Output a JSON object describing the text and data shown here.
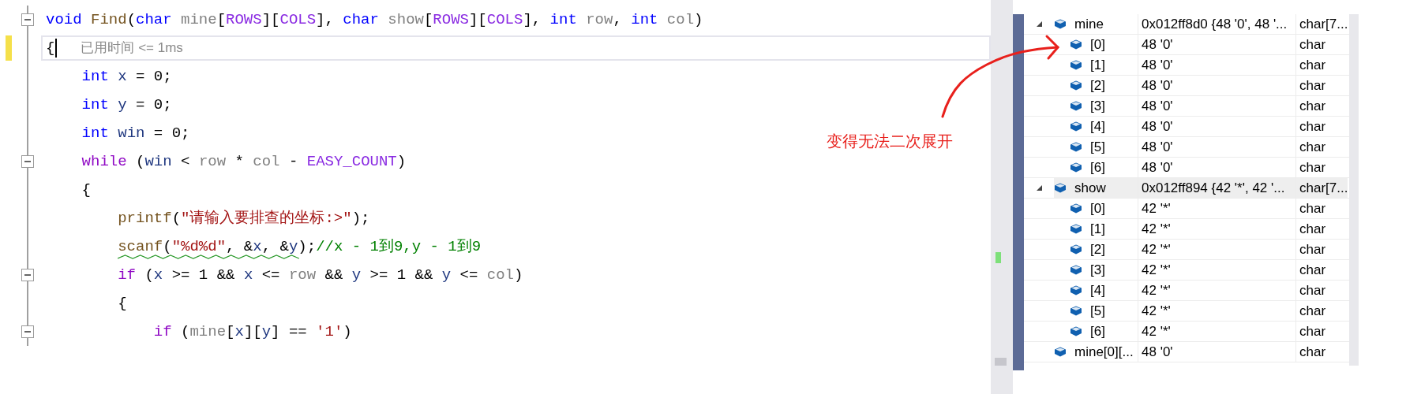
{
  "editor": {
    "lines": [
      {
        "fold": true,
        "current": false,
        "tokens": [
          {
            "text": "void",
            "kind": "kw"
          },
          {
            "text": " Find",
            "kind": "fn"
          },
          {
            "text": "(",
            "kind": "p"
          },
          {
            "text": "char",
            "kind": "kw"
          },
          {
            "text": " mine",
            "kind": "prm"
          },
          {
            "text": "[",
            "kind": "p"
          },
          {
            "text": "ROWS",
            "kind": "mac"
          },
          {
            "text": "][",
            "kind": "p"
          },
          {
            "text": "COLS",
            "kind": "mac"
          },
          {
            "text": "], ",
            "kind": "p"
          },
          {
            "text": "char",
            "kind": "kw"
          },
          {
            "text": " show",
            "kind": "prm"
          },
          {
            "text": "[",
            "kind": "p"
          },
          {
            "text": "ROWS",
            "kind": "mac"
          },
          {
            "text": "][",
            "kind": "p"
          },
          {
            "text": "COLS",
            "kind": "mac"
          },
          {
            "text": "], ",
            "kind": "p"
          },
          {
            "text": "int",
            "kind": "kw"
          },
          {
            "text": " row",
            "kind": "prm"
          },
          {
            "text": ", ",
            "kind": "p"
          },
          {
            "text": "int",
            "kind": "kw"
          },
          {
            "text": " col",
            "kind": "prm"
          },
          {
            "text": ")",
            "kind": "p"
          }
        ]
      },
      {
        "fold": false,
        "current": true,
        "hint": "已用时间 <= 1ms",
        "tokens": [
          {
            "text": "{",
            "kind": "p"
          }
        ]
      },
      {
        "fold": false,
        "current": false,
        "tokens": [
          {
            "text": "    int",
            "kind": "kw"
          },
          {
            "text": " x",
            "kind": "var"
          },
          {
            "text": " = 0;",
            "kind": "p"
          }
        ]
      },
      {
        "fold": false,
        "current": false,
        "tokens": [
          {
            "text": "    int",
            "kind": "kw"
          },
          {
            "text": " y",
            "kind": "var"
          },
          {
            "text": " = 0;",
            "kind": "p"
          }
        ]
      },
      {
        "fold": false,
        "current": false,
        "tokens": [
          {
            "text": "    int",
            "kind": "kw"
          },
          {
            "text": " win",
            "kind": "var"
          },
          {
            "text": " = 0;",
            "kind": "p"
          }
        ]
      },
      {
        "fold": true,
        "current": false,
        "tokens": [
          {
            "text": "    while",
            "kind": "ctl"
          },
          {
            "text": " (",
            "kind": "p"
          },
          {
            "text": "win",
            "kind": "var"
          },
          {
            "text": " < ",
            "kind": "p"
          },
          {
            "text": "row",
            "kind": "prm"
          },
          {
            "text": " * ",
            "kind": "p"
          },
          {
            "text": "col",
            "kind": "prm"
          },
          {
            "text": " - ",
            "kind": "p"
          },
          {
            "text": "EASY_COUNT",
            "kind": "mac"
          },
          {
            "text": ")",
            "kind": "p"
          }
        ]
      },
      {
        "fold": false,
        "current": false,
        "tokens": [
          {
            "text": "    {",
            "kind": "p"
          }
        ]
      },
      {
        "fold": false,
        "current": false,
        "tokens": [
          {
            "text": "        printf",
            "kind": "fn"
          },
          {
            "text": "(",
            "kind": "p"
          },
          {
            "text": "\"请输入要排查的坐标:>\"",
            "kind": "str"
          },
          {
            "text": ");",
            "kind": "p"
          }
        ]
      },
      {
        "fold": false,
        "current": false,
        "squiggly": [
          {
            "text": "        scanf",
            "kind": "fn"
          },
          {
            "text": "(",
            "kind": "p"
          },
          {
            "text": "\"%d%d\"",
            "kind": "str"
          },
          {
            "text": ", &",
            "kind": "p"
          },
          {
            "text": "x",
            "kind": "var"
          },
          {
            "text": ", &",
            "kind": "p"
          },
          {
            "text": "y",
            "kind": "var"
          },
          {
            "text": ")",
            "kind": "p"
          }
        ],
        "tokens": [
          {
            "text": ";",
            "kind": "p"
          },
          {
            "text": "//x - 1到9,y - 1到9",
            "kind": "cmt"
          }
        ]
      },
      {
        "fold": true,
        "current": false,
        "tokens": [
          {
            "text": "        if",
            "kind": "ctl"
          },
          {
            "text": " (",
            "kind": "p"
          },
          {
            "text": "x",
            "kind": "var"
          },
          {
            "text": " >= 1 && ",
            "kind": "p"
          },
          {
            "text": "x",
            "kind": "var"
          },
          {
            "text": " <= ",
            "kind": "p"
          },
          {
            "text": "row",
            "kind": "prm"
          },
          {
            "text": " && ",
            "kind": "p"
          },
          {
            "text": "y",
            "kind": "var"
          },
          {
            "text": " >= 1 && ",
            "kind": "p"
          },
          {
            "text": "y",
            "kind": "var"
          },
          {
            "text": " <= ",
            "kind": "p"
          },
          {
            "text": "col",
            "kind": "prm"
          },
          {
            "text": ")",
            "kind": "p"
          }
        ]
      },
      {
        "fold": false,
        "current": false,
        "tokens": [
          {
            "text": "        {",
            "kind": "p"
          }
        ]
      },
      {
        "fold": true,
        "current": false,
        "tokens": [
          {
            "text": "            if",
            "kind": "ctl"
          },
          {
            "text": " (",
            "kind": "p"
          },
          {
            "text": "mine",
            "kind": "prm"
          },
          {
            "text": "[",
            "kind": "p"
          },
          {
            "text": "x",
            "kind": "var"
          },
          {
            "text": "][",
            "kind": "p"
          },
          {
            "text": "y",
            "kind": "var"
          },
          {
            "text": "] == ",
            "kind": "p"
          },
          {
            "text": "'1'",
            "kind": "str"
          },
          {
            "text": ")",
            "kind": "p"
          }
        ]
      }
    ]
  },
  "watch": {
    "rows": [
      {
        "kind": "array",
        "expanded": true,
        "selected": false,
        "name": "mine",
        "value": "0x012ff8d0 {48 '0', 48 '...",
        "type": "char[7...",
        "children": [
          {
            "name": "[0]",
            "value": "48 '0'",
            "type": "char",
            "selected": false
          },
          {
            "name": "[1]",
            "value": "48 '0'",
            "type": "char",
            "selected": false
          },
          {
            "name": "[2]",
            "value": "48 '0'",
            "type": "char",
            "selected": false
          },
          {
            "name": "[3]",
            "value": "48 '0'",
            "type": "char",
            "selected": false
          },
          {
            "name": "[4]",
            "value": "48 '0'",
            "type": "char",
            "selected": false
          },
          {
            "name": "[5]",
            "value": "48 '0'",
            "type": "char",
            "selected": false
          },
          {
            "name": "[6]",
            "value": "48 '0'",
            "type": "char",
            "selected": false
          }
        ]
      },
      {
        "kind": "array",
        "expanded": true,
        "selected": true,
        "name": "show",
        "value": "0x012ff894 {42 '*', 42 '...",
        "type": "char[7...",
        "children": [
          {
            "name": "[0]",
            "value": "42 '*'",
            "type": "char",
            "selected": false
          },
          {
            "name": "[1]",
            "value": "42 '*'",
            "type": "char",
            "selected": false
          },
          {
            "name": "[2]",
            "value": "42 '*'",
            "type": "char",
            "selected": false
          },
          {
            "name": "[3]",
            "value": "42 '*'",
            "type": "char",
            "selected": false
          },
          {
            "name": "[4]",
            "value": "42 '*'",
            "type": "char",
            "selected": false
          },
          {
            "name": "[5]",
            "value": "42 '*'",
            "type": "char",
            "selected": false
          },
          {
            "name": "[6]",
            "value": "42 '*'",
            "type": "char",
            "selected": false
          }
        ]
      },
      {
        "kind": "value",
        "selected": false,
        "name": "mine[0][...",
        "value": "48 '0'",
        "type": "char"
      }
    ]
  },
  "annotation": {
    "text": "变得无法二次展开"
  }
}
